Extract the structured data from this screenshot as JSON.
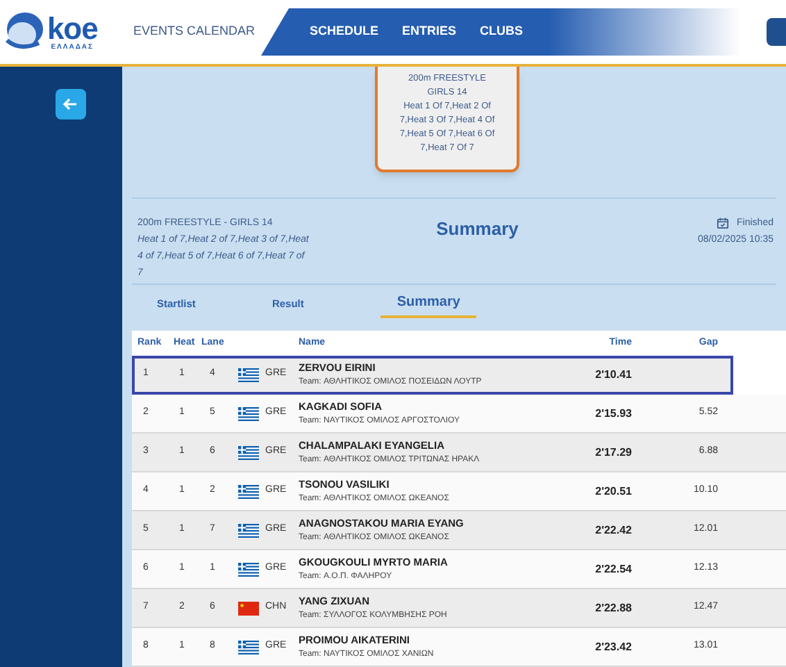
{
  "logo": {
    "mark": "koe",
    "subtitle": "ΕΛΛΑΔΑΣ"
  },
  "nav": {
    "events": "EVENTS CALENDAR",
    "items": [
      "SCHEDULE",
      "ENTRIES",
      "CLUBS"
    ]
  },
  "popup": {
    "lines": [
      "200m FREESTYLE",
      "GIRLS 14",
      "Heat 1 Of 7,Heat 2 Of 7,Heat 3 Of 7,Heat 4 Of 7,Heat 5 Of 7,Heat 6 Of 7,Heat 7 Of 7"
    ]
  },
  "event": {
    "name": "200m FREESTYLE - GIRLS 14",
    "heats": "Heat 1 of 7,Heat 2 of 7,Heat 3 of 7,Heat 4 of 7,Heat 5 of 7,Heat 6 of 7,Heat 7 of 7",
    "title": "Summary",
    "status": "Finished",
    "datetime": "08/02/2025 10:35"
  },
  "tabs": [
    {
      "label": "Startlist",
      "selected": false
    },
    {
      "label": "Result",
      "selected": false
    },
    {
      "label": "Summary",
      "selected": true
    }
  ],
  "table": {
    "columns": [
      "Rank",
      "Heat",
      "Lane",
      "Name",
      "Time",
      "Gap"
    ],
    "rows": [
      {
        "rank": "1",
        "heat": "1",
        "lane": "4",
        "kind": "greece",
        "country": "GRE",
        "name": "ZERVOU EIRINI",
        "team": "Team: ΑΘΛΗΤΙΚΟΣ ΟΜΙΛΟΣ ΠΟΣΕΙΔΩΝ ΛΟΥΤΡ",
        "time": "2'10.41",
        "selected": true
      },
      {
        "rank": "2",
        "heat": "1",
        "lane": "5",
        "kind": "greece",
        "country": "GRE",
        "name": "KAGKADI SOFIA",
        "team": "Team: ΝΑΥΤΙΚΟΣ ΟΜΙΛΟΣ ΑΡΓΟΣΤΟΛΙΟΥ",
        "time": "2'15.93",
        "gap": "5.52",
        "selected": false
      },
      {
        "rank": "3",
        "heat": "1",
        "lane": "6",
        "kind": "greece",
        "country": "GRE",
        "name": "CHALAMPALAKI EYANGELIA",
        "team": "Team: ΑΘΛΗΤΙΚΟΣ ΟΜΙΛΟΣ ΤΡΙΤΩΝΑΣ ΗΡΑΚΛ",
        "time": "2'17.29",
        "gap": "6.88",
        "selected": false
      },
      {
        "rank": "4",
        "heat": "1",
        "lane": "2",
        "kind": "greece",
        "country": "GRE",
        "name": "TSONOU VASILIKI",
        "team": "Team: ΑΘΛΗΤΙΚΟΣ ΟΜΙΛΟΣ ΩΚΕΑΝΟΣ",
        "time": "2'20.51",
        "gap": "10.10",
        "selected": false
      },
      {
        "rank": "5",
        "heat": "1",
        "lane": "7",
        "kind": "greece",
        "country": "GRE",
        "name": "ANAGNOSTAKOU MARIA EYANG",
        "team": "Team: ΑΘΛΗΤΙΚΟΣ ΟΜΙΛΟΣ ΩΚΕΑΝΟΣ",
        "time": "2'22.42",
        "gap": "12.01",
        "selected": false
      },
      {
        "rank": "6",
        "heat": "1",
        "lane": "1",
        "kind": "greece",
        "country": "GRE",
        "name": "GKOUGKOULI MYRTO MARIA",
        "team": "Team: Α.Ο.Π. ΦΑΛΗΡΟΥ",
        "time": "2'22.54",
        "gap": "12.13",
        "selected": false
      },
      {
        "rank": "7",
        "heat": "2",
        "lane": "6",
        "kind": "china",
        "country": "CHN",
        "name": "YANG ZIXUAN",
        "team": "Team: ΣΥΛΛΟΓΟΣ ΚΟΛΥΜΒΗΣΗΣ ΡΟΗ",
        "time": "2'22.88",
        "gap": "12.47",
        "selected": false
      },
      {
        "rank": "8",
        "heat": "1",
        "lane": "8",
        "kind": "greece",
        "country": "GRE",
        "name": "PROIMOU AIKATERINI",
        "team": "Team: ΝΑΥΤΙΚΟΣ ΟΜΙΛΟΣ ΧΑΝΙΩΝ",
        "time": "2'23.42",
        "gap": "13.01",
        "selected": false
      }
    ]
  }
}
